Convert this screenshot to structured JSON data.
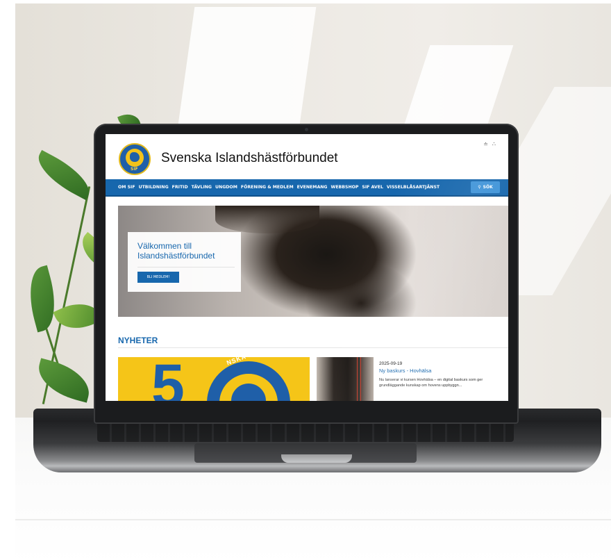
{
  "site": {
    "title": "Svenska Islandshästförbundet",
    "logo_text": "SIF"
  },
  "nav": {
    "items": [
      {
        "label": "OM SIF"
      },
      {
        "label": "UTBILDNING"
      },
      {
        "label": "FRITID"
      },
      {
        "label": "TÄVLING"
      },
      {
        "label": "UNGDOM"
      },
      {
        "label": "FÖRENING & MEDLEM"
      },
      {
        "label": "EVENEMANG"
      },
      {
        "label": "WEBBSHOP"
      },
      {
        "label": "SIF AVEL"
      },
      {
        "label": "VISSELBLÅSARTJÄNST"
      }
    ],
    "search_label": "SÖK"
  },
  "top_icons": [
    "rss-icon",
    "sitemap-icon"
  ],
  "hero": {
    "title": "Välkommen till Islandshästförbundet",
    "button_label": "BLI MEDLEM!"
  },
  "news": {
    "heading": "NYHETER",
    "featured": {
      "number": "5",
      "emblem_text": "NSKA ISLANDSHÄSTFÖRBUN"
    },
    "items": [
      {
        "date": "2025-09-19",
        "title": "Ny baskurs - Hovhälsa",
        "description": "Nu lanserar vi kursen Hovhälsa – en digital baskurs som ger grundläggande kunskap om hovens uppbyggn..."
      }
    ]
  },
  "colors": {
    "brand_blue": "#1767ad",
    "logo_yellow": "#f5c518",
    "search_button": "#3e93d8"
  }
}
